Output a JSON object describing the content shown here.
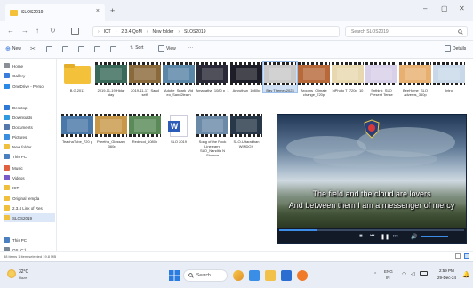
{
  "window": {
    "tab_title": "SLOS2019",
    "tab_close": "×",
    "tab_new": "+",
    "min_label": "–",
    "max_label": "▢",
    "close_label": "✕"
  },
  "nav": {
    "back": "←",
    "forward": "→",
    "up": "↑",
    "refresh": "↻",
    "breadcrumbs": [
      "ICT",
      "2.3.4 QoM",
      "New folder",
      "SLOS2019"
    ],
    "search_placeholder": "Search SLOS2019"
  },
  "toolbar": {
    "new_label": "New",
    "sort_label": "Sort",
    "view_label": "View",
    "more_label": "···",
    "details_label": "Details"
  },
  "sidebar": {
    "items": [
      {
        "label": "Home",
        "icon": "home-icon",
        "color": "#8a8f98"
      },
      {
        "label": "Gallery",
        "icon": "gallery-icon",
        "color": "#3b7ddd"
      },
      {
        "label": "OneDrive - Perso",
        "icon": "onedrive-icon",
        "color": "#2b8ae6"
      },
      {
        "label": "Desktop",
        "icon": "desktop-icon",
        "color": "#2e78d6"
      },
      {
        "label": "Downloads",
        "icon": "downloads-icon",
        "color": "#2f9ae0"
      },
      {
        "label": "Documents",
        "icon": "documents-icon",
        "color": "#5577aa"
      },
      {
        "label": "Pictures",
        "icon": "pictures-icon",
        "color": "#3b8de0"
      },
      {
        "label": "New folder",
        "icon": "folder-icon",
        "color": "#f0bf3c"
      },
      {
        "label": "This PC",
        "icon": "pc-icon",
        "color": "#4a7fc0"
      },
      {
        "label": "Music",
        "icon": "music-icon",
        "color": "#e06040"
      },
      {
        "label": "Videos",
        "icon": "videos-icon",
        "color": "#7a5ac8"
      },
      {
        "label": "ICT",
        "icon": "folder-icon",
        "color": "#f0bf3c"
      },
      {
        "label": "Original templa",
        "icon": "folder-icon",
        "color": "#f0bf3c"
      },
      {
        "label": "2.3.4 Link of Res",
        "icon": "folder-icon",
        "color": "#f0bf3c"
      },
      {
        "label": "SLOS2019",
        "icon": "folder-icon",
        "color": "#f0bf3c"
      },
      {
        "label": "This PC",
        "icon": "pc-icon",
        "color": "#4a7fc0"
      },
      {
        "label": "OS (C:)",
        "icon": "drive-icon",
        "color": "#7a8796"
      },
      {
        "label": "DATA (D:)",
        "icon": "drive-icon",
        "color": "#7a8796"
      }
    ]
  },
  "files_row1": [
    {
      "name": "B.G.2011",
      "kind": "folder"
    },
    {
      "name": "2019-11-19 Hidar day",
      "kind": "video",
      "bg": "#3a6b5a"
    },
    {
      "name": "2019-11-17_Sand selfi",
      "kind": "video",
      "bg": "#8a6a3a"
    },
    {
      "name": "Adobe_Spark_Vid eo_Sand2learn",
      "kind": "video",
      "bg": "#5a86a8"
    },
    {
      "name": "Amanatha_1080 p_1",
      "kind": "video",
      "bg": "#2a2a38"
    },
    {
      "name": "Amruthan_1080p",
      "kind": "video",
      "bg": "#1e1e28"
    },
    {
      "name": "Bay Themes2023",
      "kind": "video",
      "bg": "#c8c8c8"
    },
    {
      "name": "Arooms_Climate change_720p",
      "kind": "video",
      "bg": "#b8693a"
    },
    {
      "name": "biPhoto T_720p_10",
      "kind": "video",
      "bg": "#e8d8b0"
    },
    {
      "name": "Snthink_SLO Present Tense",
      "kind": "video",
      "bg": "#d8d0e8"
    },
    {
      "name": "BeeHome_SLO adverbs_360p",
      "kind": "video",
      "bg": "#e8b070"
    },
    {
      "name": "Intro",
      "kind": "video",
      "bg": "#c8d8e8"
    }
  ],
  "files_row2": [
    {
      "name": "TeachaTube_720 p",
      "kind": "video",
      "bg": "#4a78a8"
    },
    {
      "name": "Preetha_Glossary _360p",
      "kind": "video",
      "bg": "#c89848"
    },
    {
      "name": "Redmod_1080p",
      "kind": "video",
      "bg": "#5a8a58"
    },
    {
      "name": "SLO 2019",
      "kind": "word"
    },
    {
      "name": "Song of the Rock Linelearnt SLO_Nandita N Sharma",
      "kind": "video",
      "bg": "#6a8aa8"
    },
    {
      "name": "SLO-Uttarakhan WINDOX",
      "kind": "video",
      "bg": "#283848"
    }
  ],
  "player": {
    "subtitle_line1": "The field and the cloud are lovers",
    "subtitle_line2": "And between them I am a messenger of mercy",
    "progress": 0.2
  },
  "statusbar": {
    "summary": "38 items   1 item selected  19.8 MB"
  },
  "taskbar": {
    "weather_temp": "32°C",
    "weather_desc": "Haze",
    "search_label": "Search",
    "lang": "ENG",
    "lang2": "IN",
    "time": "2:59 PM",
    "date": "29-Dec-24"
  }
}
